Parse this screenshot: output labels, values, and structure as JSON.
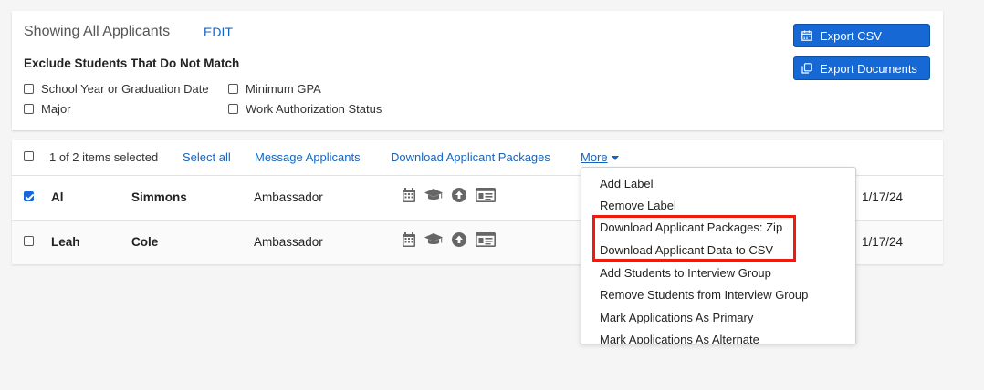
{
  "filter": {
    "title": "Showing All Applicants",
    "edit_label": "EDIT",
    "subtitle": "Exclude Students That Do Not Match",
    "options": [
      "School Year or Graduation Date",
      "Minimum GPA",
      "Major",
      "Work Authorization Status"
    ],
    "export_csv_label": "Export CSV",
    "export_documents_label": "Export Documents"
  },
  "toolbar": {
    "selection_text": "1 of 2 items selected",
    "select_all": "Select all",
    "message_applicants": "Message Applicants",
    "download_packages": "Download Applicant Packages",
    "more": "More"
  },
  "rows": [
    {
      "first": "Al",
      "last": "Simmons",
      "role": "Ambassador",
      "date": "1/17/24",
      "checked": true
    },
    {
      "first": "Leah",
      "last": "Cole",
      "role": "Ambassador",
      "date": "1/17/24",
      "checked": false
    }
  ],
  "menu": {
    "items": [
      "Add Label",
      "Remove Label",
      "Download Applicant Packages: Zip",
      "Download Applicant Data to CSV",
      "Add Students to Interview Group",
      "Remove Students from Interview Group",
      "Mark Applications As Primary",
      "Mark Applications As Alternate"
    ]
  },
  "icons": {
    "row_icons": [
      "calendar-icon",
      "graduation-cap-icon",
      "upload-circle-icon",
      "id-card-icon"
    ],
    "export_csv": "calendar-icon",
    "export_documents": "documents-icon"
  },
  "colors": {
    "primary": "#1668d4",
    "link": "#1565c0",
    "highlight": "#ee1c0f",
    "icon_gray": "#666666"
  }
}
